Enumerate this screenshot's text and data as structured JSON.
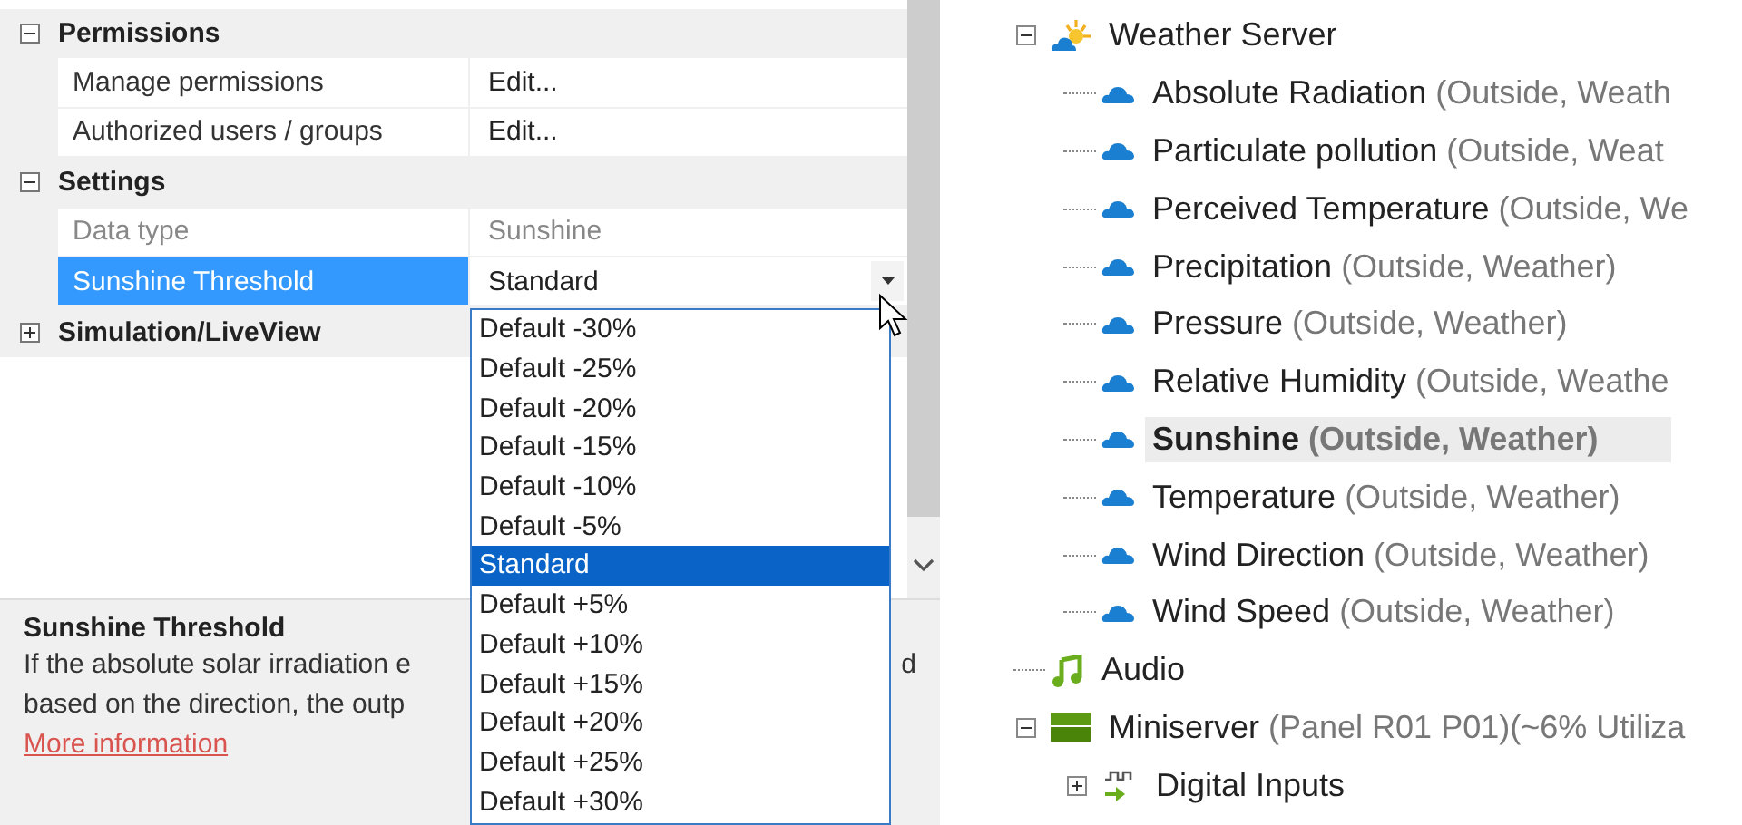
{
  "property_grid": {
    "categories": [
      {
        "title": "Permissions",
        "expanded": true,
        "rows": [
          {
            "label": "Manage permissions",
            "value": "Edit...",
            "disabled": false,
            "selected": false,
            "kind": "text"
          },
          {
            "label": "Authorized users / groups",
            "value": "Edit...",
            "disabled": false,
            "selected": false,
            "kind": "text"
          }
        ]
      },
      {
        "title": "Settings",
        "expanded": true,
        "rows": [
          {
            "label": "Data type",
            "value": "Sunshine",
            "disabled": true,
            "selected": false,
            "kind": "text"
          },
          {
            "label": "Sunshine Threshold",
            "value": "Standard",
            "disabled": false,
            "selected": true,
            "kind": "dropdown"
          }
        ]
      },
      {
        "title": "Simulation/LiveView",
        "expanded": false
      }
    ]
  },
  "dropdown_list": {
    "options": [
      {
        "label": "Default -30%",
        "selected": false
      },
      {
        "label": "Default -25%",
        "selected": false
      },
      {
        "label": "Default -20%",
        "selected": false
      },
      {
        "label": "Default -15%",
        "selected": false
      },
      {
        "label": "Default -10%",
        "selected": false
      },
      {
        "label": "Default -5%",
        "selected": false
      },
      {
        "label": "Standard",
        "selected": true
      },
      {
        "label": "Default +5%",
        "selected": false
      },
      {
        "label": "Default +10%",
        "selected": false
      },
      {
        "label": "Default +15%",
        "selected": false
      },
      {
        "label": "Default +20%",
        "selected": false
      },
      {
        "label": "Default +25%",
        "selected": false
      },
      {
        "label": "Default +30%",
        "selected": false
      }
    ]
  },
  "description": {
    "title": "Sunshine Threshold",
    "line_1": "If the absolute solar irradiation e",
    "line_1_end": "d",
    "line_2": "based on the direction, the outp",
    "link": "More information"
  },
  "tree": {
    "items": [
      {
        "name": "Weather Server",
        "kind": "sun-cloud",
        "expanded": true,
        "selected": false,
        "children": [
          {
            "name": "Absolute Radiation",
            "detail": "(Outside, Weath",
            "kind": "cloud",
            "selected": false
          },
          {
            "name": "Particulate pollution",
            "detail": "(Outside, Weat",
            "kind": "cloud",
            "selected": false
          },
          {
            "name": "Perceived Temperature",
            "detail": "(Outside, We",
            "kind": "cloud",
            "selected": false
          },
          {
            "name": "Precipitation",
            "detail": "(Outside, Weather)",
            "kind": "cloud",
            "selected": false
          },
          {
            "name": "Pressure",
            "detail": "(Outside, Weather)",
            "kind": "cloud",
            "selected": false
          },
          {
            "name": "Relative Humidity",
            "detail": "(Outside, Weathe",
            "kind": "cloud",
            "selected": false
          },
          {
            "name": "Sunshine",
            "detail": "(Outside, Weather)",
            "kind": "cloud",
            "selected": true
          },
          {
            "name": "Temperature",
            "detail": "(Outside, Weather)",
            "kind": "cloud",
            "selected": false
          },
          {
            "name": "Wind Direction",
            "detail": "(Outside, Weather)",
            "kind": "cloud",
            "selected": false
          },
          {
            "name": "Wind Speed",
            "detail": "(Outside, Weather)",
            "kind": "cloud",
            "selected": false
          }
        ]
      },
      {
        "name": "Audio",
        "kind": "music",
        "selected": false
      },
      {
        "name": "Miniserver",
        "detail": "(Panel R01 P01)(~6% Utiliza",
        "kind": "server",
        "expanded": true,
        "selected": false,
        "children": [
          {
            "name": "Digital Inputs",
            "kind": "digital",
            "expanded": false,
            "selected": false
          }
        ]
      }
    ]
  }
}
